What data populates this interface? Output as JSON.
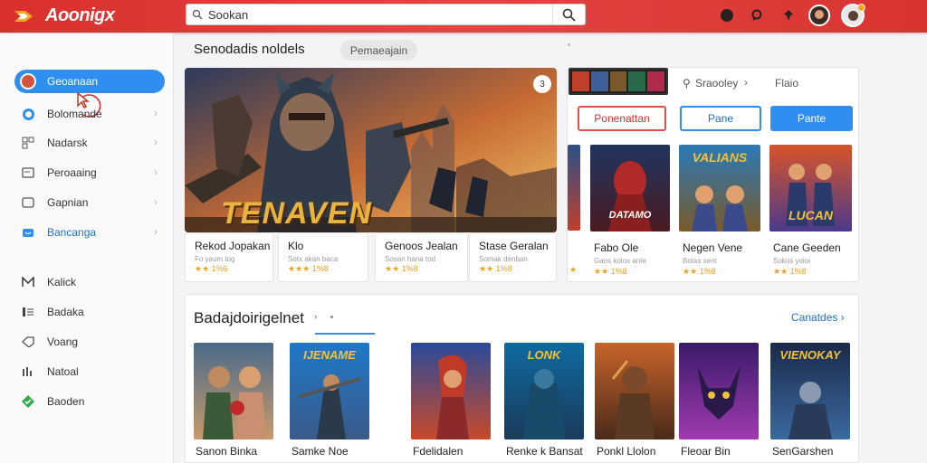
{
  "app": {
    "title": "Aoonigx"
  },
  "search": {
    "value": "Sookan",
    "placeholder": ""
  },
  "header_icons": [
    "circle-icon",
    "search-small-icon",
    "pin-icon",
    "user-avatar",
    "profile-avatar"
  ],
  "sidebar": {
    "items": [
      {
        "label": "Geoanaan",
        "icon": "user-icon",
        "active": true
      },
      {
        "label": "Bolomande",
        "icon": "circle-icon"
      },
      {
        "label": "Nadarsk",
        "icon": "grid-icon"
      },
      {
        "label": "Peroaaing",
        "icon": "card-icon"
      },
      {
        "label": "Gapnian",
        "icon": "square-icon"
      },
      {
        "label": "Bancanga",
        "icon": "folder-icon",
        "highlight": true
      }
    ],
    "items2": [
      {
        "label": "Kalick",
        "icon": "mail-icon"
      },
      {
        "label": "Badaka",
        "icon": "list-icon"
      },
      {
        "label": "Voang",
        "icon": "tag-icon"
      },
      {
        "label": "Natoal",
        "icon": "chart-icon"
      },
      {
        "label": "Baoden",
        "icon": "check-icon"
      }
    ]
  },
  "section": {
    "title": "Senodadis noldels",
    "pill": "Pemaeajain"
  },
  "hero": {
    "title": "TENAVEN",
    "badge": "3"
  },
  "cards": [
    {
      "title": "Rekod Jopakan",
      "sub": "Fo yaum tog",
      "rating": "★★ 1%6"
    },
    {
      "title": "Klo",
      "sub": "Sotx akan baca",
      "rating": "★★★ 1%8"
    },
    {
      "title": "Genoos Jealan",
      "sub": "Sosan hana tod",
      "rating": "★★ 1%8"
    },
    {
      "title": "Stase Geralan",
      "sub": "Somak denban",
      "rating": "★★ 1%8"
    }
  ],
  "panel": {
    "tabs": [
      "Sraooley",
      "Flaio"
    ],
    "buttons": [
      "Ponenattan",
      "Pane",
      "Pante"
    ],
    "games": [
      {
        "cover": "DATAMO",
        "title": "Fabo Ole",
        "sub": "Gaos kolos ante",
        "rating": "★★ 1%8"
      },
      {
        "cover": "VALIANS",
        "title": "Negen Vene",
        "sub": "Botas sent",
        "rating": "★★ 1%8"
      },
      {
        "cover": "LUCAN",
        "title": "Cane Geeden",
        "sub": "Sokos yoloi",
        "rating": "★★ 1%8"
      }
    ]
  },
  "lower": {
    "title": "Badajdoirigelnet",
    "link": "Canatdes",
    "games": [
      {
        "title": "Sanon Binka",
        "cover": ""
      },
      {
        "title": "Samke Noe",
        "cover": "IJENAME"
      },
      {
        "title": "Fdelidalen",
        "cover": ""
      },
      {
        "title": "Renke k Bansat",
        "cover": "LONK"
      },
      {
        "title": "Ponkl Llolon",
        "cover": ""
      },
      {
        "title": "Fleoar Bin",
        "cover": ""
      },
      {
        "title": "SenGarshen",
        "cover": "VIENOKAY"
      }
    ]
  },
  "colors": {
    "topbar": "#e03e3b",
    "accent": "#2e8ff0",
    "link": "#1f6fd1",
    "star": "#f0a020"
  }
}
